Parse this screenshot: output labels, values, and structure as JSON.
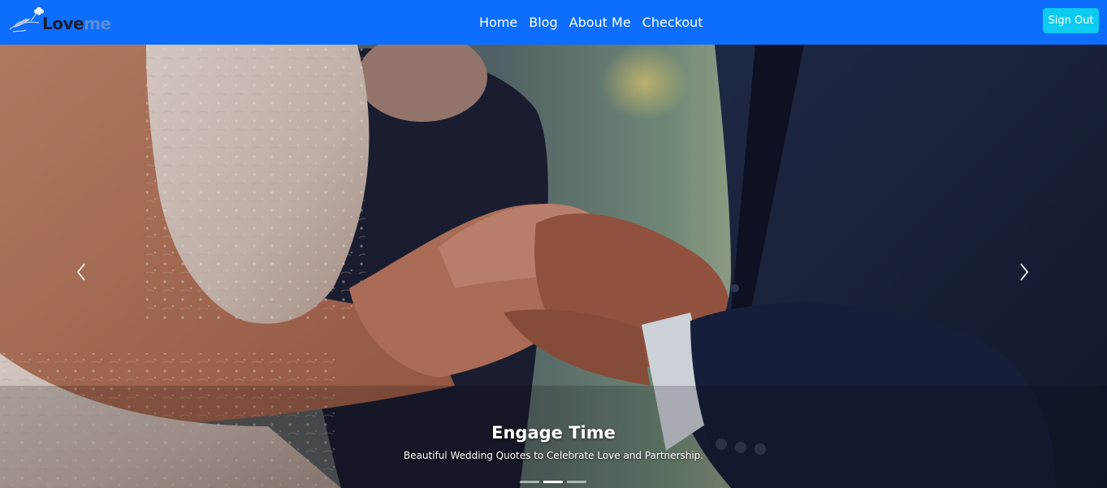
{
  "brand": {
    "text_love": "Love",
    "text_me": "me",
    "logo_icon": "flower-leaf-logo"
  },
  "nav": {
    "links": [
      {
        "label": "Home"
      },
      {
        "label": "Blog"
      },
      {
        "label": "About Me"
      },
      {
        "label": "Checkout"
      }
    ],
    "signout_label": "Sign Out"
  },
  "carousel": {
    "caption_title": "Engage Time",
    "caption_subtitle": "Beautiful Wedding Quotes to Celebrate Love and Partnership.",
    "prev_icon": "chevron-left-icon",
    "next_icon": "chevron-right-icon",
    "slide_count": 3,
    "active_slide": 2
  },
  "colors": {
    "navbar": "#0d6efd",
    "signout_button": "#0dcaf0",
    "nav_text": "#ffffff"
  }
}
